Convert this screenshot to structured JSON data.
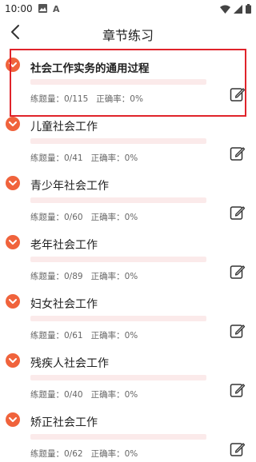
{
  "status_bar": {
    "time": "10:00"
  },
  "header": {
    "title": "章节练习"
  },
  "labels": {
    "practiced": "练题量：",
    "accuracy": "正确率："
  },
  "colors": {
    "accent": "#f0633c",
    "highlight_border": "#e0242b",
    "track": "#fbeaea"
  },
  "chapters": [
    {
      "title": "社会工作实务的通用过程",
      "practiced": "0/115",
      "accuracy": "0%",
      "progress": 0
    },
    {
      "title": "儿童社会工作",
      "practiced": "0/41",
      "accuracy": "0%",
      "progress": 0
    },
    {
      "title": "青少年社会工作",
      "practiced": "0/60",
      "accuracy": "0%",
      "progress": 0
    },
    {
      "title": "老年社会工作",
      "practiced": "0/89",
      "accuracy": "0%",
      "progress": 0
    },
    {
      "title": "妇女社会工作",
      "practiced": "0/61",
      "accuracy": "0%",
      "progress": 0
    },
    {
      "title": "残疾人社会工作",
      "practiced": "0/40",
      "accuracy": "0%",
      "progress": 0
    },
    {
      "title": "矫正社会工作",
      "practiced": "0/62",
      "accuracy": "0%",
      "progress": 0
    }
  ]
}
